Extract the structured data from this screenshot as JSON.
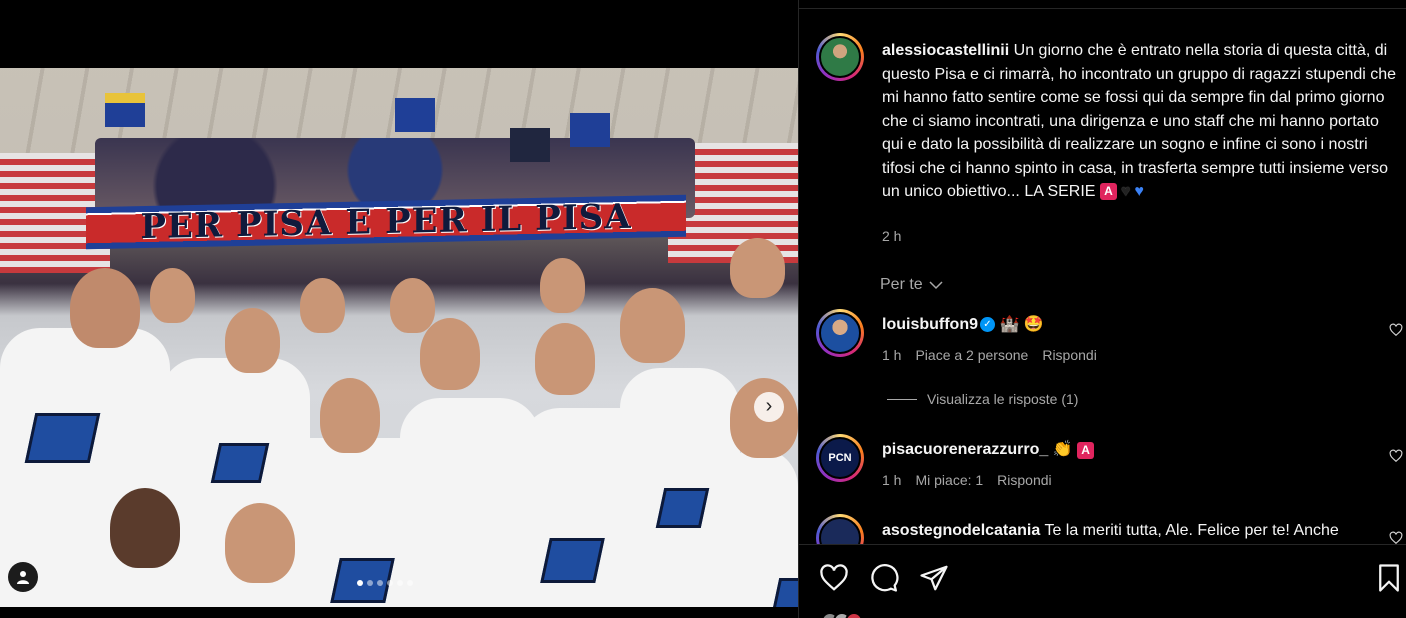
{
  "post": {
    "author": "alessiocastellinii",
    "caption": "Un giorno che è entrato nella storia di questa città, di questo Pisa e ci rimarrà, ho incontrato un gruppo di ragazzi stupendi che mi hanno fatto sentire come se fossi qui da sempre fin dal primo giorno che ci siamo incontrati, una dirigenza e uno staff che mi hanno portato qui e dato la possibilità di realizzare un sogno e infine ci sono i nostri tifosi che ci hanno spinto in casa, in trasferta sempre tutti insieme verso un unico obiettivo... LA SERIE",
    "caption_badge": "A",
    "time": "2 h"
  },
  "media": {
    "banner_text": "PER PISA E PER IL PISA",
    "carousel_count": 6,
    "carousel_active": 0
  },
  "feed_filter": {
    "label": "Per te"
  },
  "comments": [
    {
      "user": "louisbuffon9",
      "verified": true,
      "text": "🏰 🤩",
      "time": "1 h",
      "likes": "Piace a 2 persone",
      "reply": "Rispondi",
      "view_replies": "Visualizza le risposte (1)"
    },
    {
      "user": "pisacuorenerazzurro_",
      "text": "👏",
      "badge": "A",
      "time": "1 h",
      "likes": "Mi piace: 1",
      "reply": "Rispondi",
      "avatar_text": "PCN"
    },
    {
      "user": "asostegnodelcatania",
      "text": "Te la meriti tutta, Ale. Felice per te! Anche"
    }
  ],
  "colors": {
    "background": "#000000",
    "text": "#f5f5f5",
    "muted": "#a8a8a8",
    "verified": "#0095f6",
    "badge": "#e0245e"
  }
}
